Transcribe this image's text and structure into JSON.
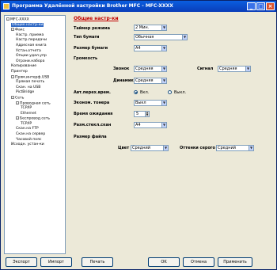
{
  "window": {
    "title": "Программа Удалённой настройки Brother MFC - MFC-XXXX"
  },
  "tree": {
    "items": [
      {
        "label": "MFC-XXXX",
        "level": 0,
        "glyph": "-"
      },
      {
        "label": "Общие настр-ки",
        "level": 1,
        "glyph": "",
        "selected": true
      },
      {
        "label": "Факс",
        "level": 1,
        "glyph": "-"
      },
      {
        "label": "Настр. приема",
        "level": 2,
        "glyph": ""
      },
      {
        "label": "Настр.передачи",
        "level": 2,
        "glyph": ""
      },
      {
        "label": "Адресная книга",
        "level": 2,
        "glyph": ""
      },
      {
        "label": "Устан.отчета",
        "level": 2,
        "glyph": ""
      },
      {
        "label": "Опции удал.упр",
        "level": 2,
        "glyph": ""
      },
      {
        "label": "Ограни.набора",
        "level": 2,
        "glyph": ""
      },
      {
        "label": "Копирование",
        "level": 1,
        "glyph": ""
      },
      {
        "label": "Принтер",
        "level": 1,
        "glyph": ""
      },
      {
        "label": "Прям.интерф.USB",
        "level": 1,
        "glyph": "-"
      },
      {
        "label": "Прямая печать",
        "level": 2,
        "glyph": ""
      },
      {
        "label": "Скан. на USB",
        "level": 2,
        "glyph": ""
      },
      {
        "label": "PictBridge",
        "level": 2,
        "glyph": ""
      },
      {
        "label": "Сеть",
        "level": 1,
        "glyph": "-"
      },
      {
        "label": "Проводная сеть",
        "level": 2,
        "glyph": "-"
      },
      {
        "label": "TCP/IP",
        "level": 3,
        "glyph": ""
      },
      {
        "label": "Ethernet",
        "level": 3,
        "glyph": ""
      },
      {
        "label": "Беспровод.сеть",
        "level": 2,
        "glyph": "-"
      },
      {
        "label": "TCP/IP",
        "level": 3,
        "glyph": ""
      },
      {
        "label": "Скан.на FTP",
        "level": 2,
        "glyph": ""
      },
      {
        "label": "Скан.на сервер",
        "level": 2,
        "glyph": ""
      },
      {
        "label": "Часовой пояс",
        "level": 2,
        "glyph": ""
      },
      {
        "label": "Исходн. устан-ки",
        "level": 1,
        "glyph": ""
      }
    ]
  },
  "panel": {
    "title": "Общие настр-ки",
    "mode_timer": {
      "label": "Таймер режима",
      "value": "2 Мин."
    },
    "paper_type": {
      "label": "Тип бумаги",
      "value": "Обычная"
    },
    "paper_size": {
      "label": "Размер бумаги",
      "value": "A4"
    },
    "volume": {
      "label": "Громкость"
    },
    "ring": {
      "label": "Звонок",
      "value": "Средняя"
    },
    "beeper": {
      "label": "Сигнал",
      "value": "Средняя"
    },
    "speaker": {
      "label": "Динамик",
      "value": "Средняя"
    },
    "auto_dst": {
      "label": "Авт.перех.врем.",
      "on_label": "Вкл.",
      "off_label": "Выкл.",
      "selected": "on"
    },
    "toner_save": {
      "label": "Эконом. тонера",
      "value": "Выкл"
    },
    "sleep_time": {
      "label": "Время ожидания",
      "value": "5"
    },
    "glass_scan_size": {
      "label": "Разм.стекл.скан",
      "value": "A4"
    },
    "file_size": {
      "label": "Размер файла"
    },
    "color": {
      "label": "Цвет",
      "value": "Средний"
    },
    "gray": {
      "label": "Оттенки серого",
      "value": "Средний"
    }
  },
  "buttons": {
    "export": "Экспорт",
    "import": "Импорт",
    "print": "Печать",
    "ok": "OK",
    "cancel": "Отмена",
    "apply": "Применить"
  },
  "title_buttons": {
    "minimize": "_",
    "maximize": "□",
    "close": "×"
  }
}
